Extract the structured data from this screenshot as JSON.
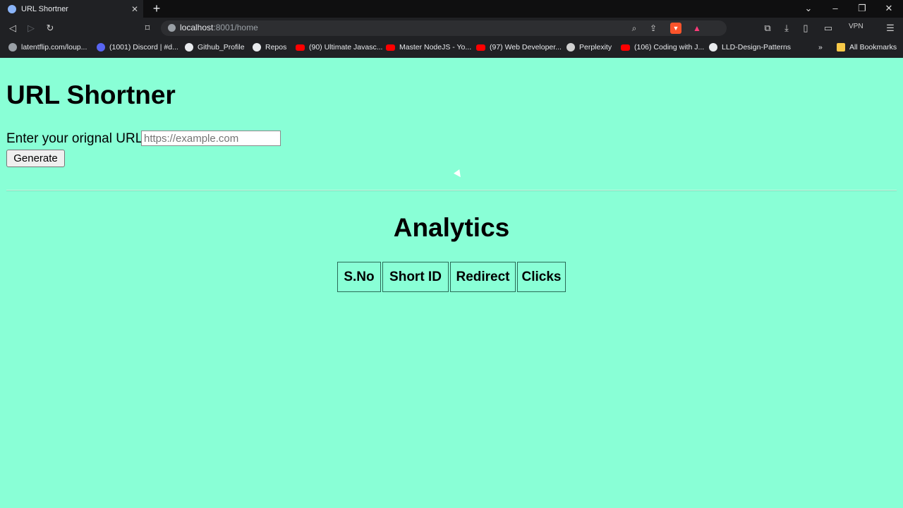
{
  "tab": {
    "title": "URL Shortner"
  },
  "address_bar": {
    "host": "localhost",
    "path": ":8001/home"
  },
  "vpn_label": "VPN",
  "bookmarks": [
    {
      "label": "latentflip.com/loup...",
      "icon": "globe-icon"
    },
    {
      "label": "(1001) Discord | #d...",
      "icon": "discord-icon"
    },
    {
      "label": "Github_Profile",
      "icon": "github-icon"
    },
    {
      "label": "Repos",
      "icon": "github-icon"
    },
    {
      "label": "(90) Ultimate Javasc...",
      "icon": "youtube-icon"
    },
    {
      "label": "Master NodeJS - Yo...",
      "icon": "youtube-icon"
    },
    {
      "label": "(97) Web Developer...",
      "icon": "youtube-icon"
    },
    {
      "label": "Perplexity",
      "icon": "perplexity-icon"
    },
    {
      "label": "(106) Coding with J...",
      "icon": "youtube-icon"
    },
    {
      "label": "LLD-Design-Patterns",
      "icon": "github-icon"
    }
  ],
  "all_bookmarks_label": "All Bookmarks",
  "page": {
    "title": "URL Shortner",
    "form": {
      "label": "Enter your orignal URL",
      "placeholder": "https://example.com",
      "value": "",
      "button_label": "Generate"
    },
    "analytics": {
      "title": "Analytics",
      "columns": [
        "S.No",
        "Short ID",
        "Redirect",
        "Clicks"
      ],
      "rows": []
    }
  },
  "colors": {
    "background": "#89ffd6",
    "browser_chrome": "#202124"
  }
}
